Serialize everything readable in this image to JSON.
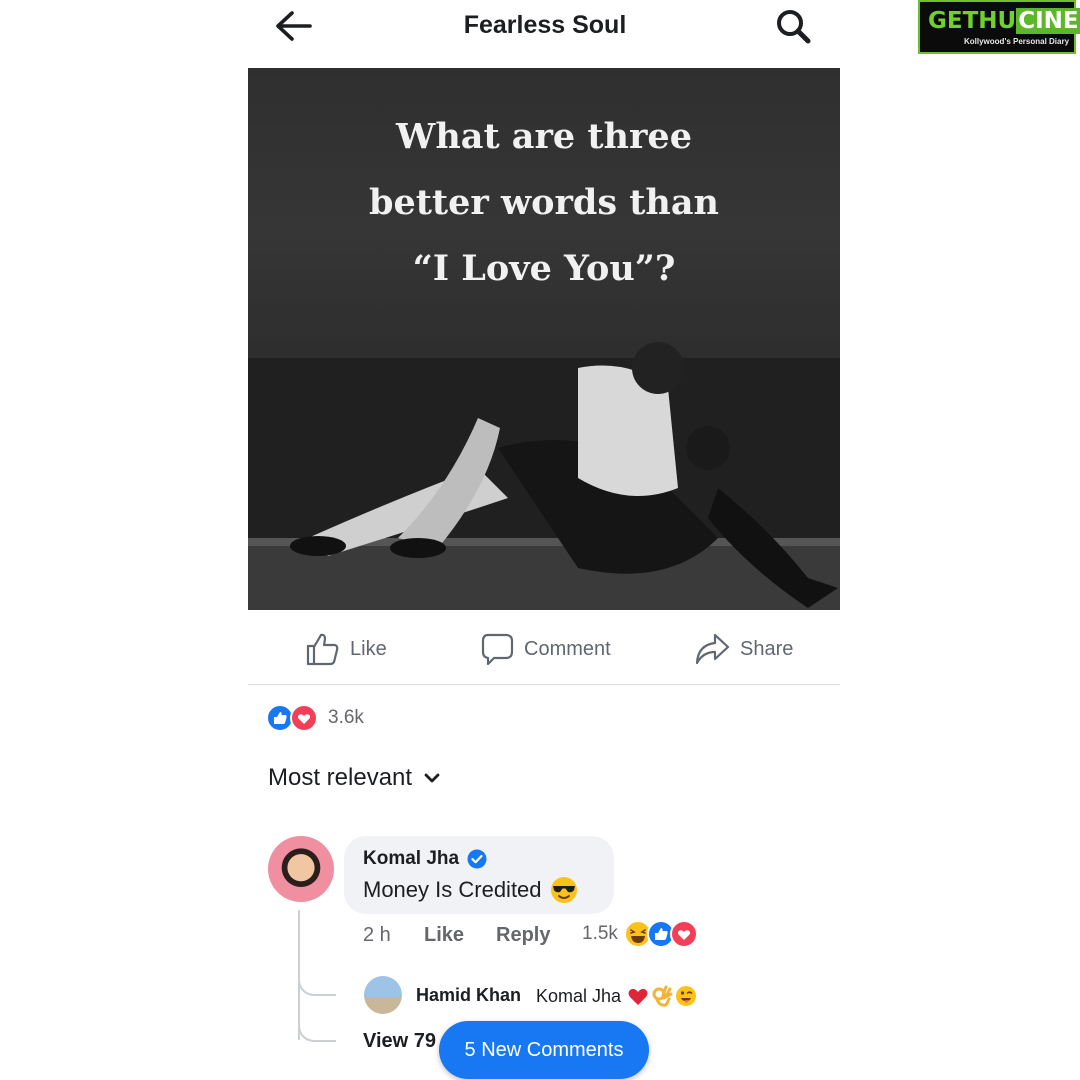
{
  "watermark": {
    "brand_part1": "GETHU",
    "brand_part2": "CINEMA",
    "tagline": "Kollywood's Personal Diary"
  },
  "header": {
    "title": "Fearless Soul",
    "back_icon": "arrow-left-icon",
    "search_icon": "search-icon"
  },
  "post": {
    "image_text": [
      "What are three",
      "better words than",
      "“I Love You”?"
    ],
    "image_subject": "black-and-white photo of a couple embracing on a seawall"
  },
  "actions": {
    "like": "Like",
    "comment": "Comment",
    "share": "Share"
  },
  "reactions": {
    "count": "3.6k",
    "types": [
      "like",
      "love"
    ]
  },
  "sort": {
    "label": "Most relevant"
  },
  "comment": {
    "author": "Komal Jha",
    "verified": true,
    "text": "Money Is Credited",
    "emoji": "sunglasses-face",
    "time": "2 h",
    "like_label": "Like",
    "reply_label": "Reply",
    "reaction_count": "1.5k",
    "reaction_types": [
      "haha",
      "like",
      "love"
    ]
  },
  "reply": {
    "author": "Hamid Khan",
    "text": "Komal Jha",
    "emojis": [
      "red-heart",
      "ok-hand",
      "winking-tongue-face"
    ]
  },
  "thread": {
    "view_more": "View 79",
    "new_comments_button": "5 New Comments"
  },
  "colors": {
    "fb_blue": "#1877f2",
    "love_red": "#f33e58",
    "bubble": "#f0f2f5"
  }
}
